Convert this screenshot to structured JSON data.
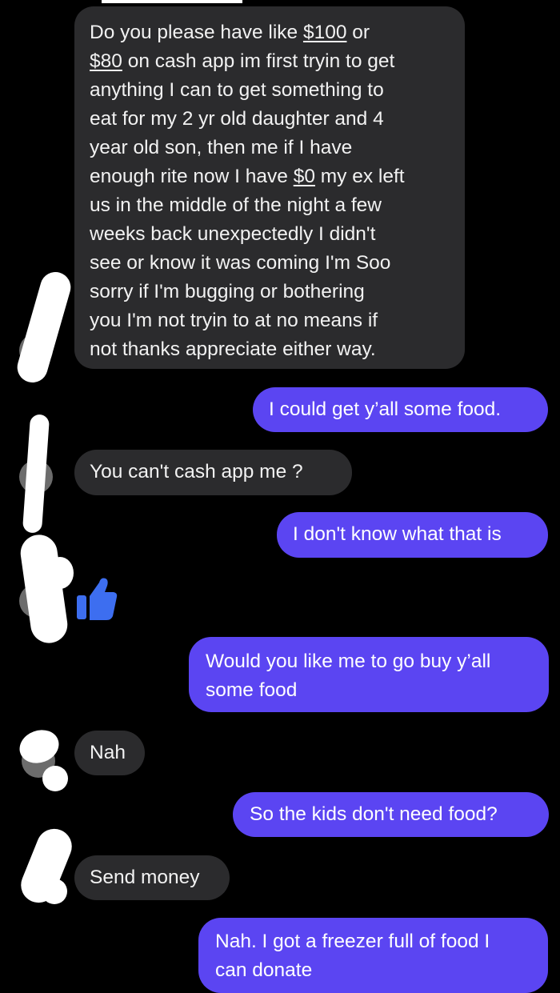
{
  "messages": [
    {
      "id": "m1",
      "side": "received",
      "lines": [
        [
          "Do you please have  like ",
          {
            "money": "$100"
          },
          " or"
        ],
        [
          {
            "money": "$80"
          },
          " on cash app im first tryin to get"
        ],
        [
          "anything I can to get something to"
        ],
        [
          "eat for my 2 yr old daughter and 4"
        ],
        [
          "year old son, then me if I have"
        ],
        [
          "enough rite now I have ",
          {
            "money": "$0"
          },
          " my ex left"
        ],
        [
          "us in the middle of the night a few"
        ],
        [
          "weeks back unexpectedly I didn't"
        ],
        [
          "see or know it was coming I'm  Soo"
        ],
        [
          "sorry  if I'm bugging or bothering"
        ],
        [
          "you I'm not tryin to at  no means if"
        ],
        [
          "not thanks  appreciate either way."
        ]
      ]
    },
    {
      "id": "m2",
      "side": "sent",
      "lines": [
        [
          "I could get y’all some food."
        ]
      ]
    },
    {
      "id": "m3",
      "side": "received",
      "lines": [
        [
          "You can't  cash app me ?"
        ]
      ]
    },
    {
      "id": "m4",
      "side": "sent",
      "lines": [
        [
          "I don't know what that is"
        ]
      ]
    },
    {
      "id": "m5",
      "side": "received",
      "reaction": "thumbs-up-icon"
    },
    {
      "id": "m6",
      "side": "sent",
      "lines": [
        [
          "Would you like me to go buy y’all"
        ],
        [
          "some food"
        ]
      ]
    },
    {
      "id": "m7",
      "side": "received",
      "lines": [
        [
          "Nah"
        ]
      ]
    },
    {
      "id": "m8",
      "side": "sent",
      "lines": [
        [
          "So the kids don't need food?"
        ]
      ]
    },
    {
      "id": "m9",
      "side": "received",
      "lines": [
        [
          "Send money"
        ]
      ]
    },
    {
      "id": "m10",
      "side": "sent",
      "lines": [
        [
          "Nah. I got a freezer full of food I"
        ],
        [
          "can donate"
        ]
      ]
    }
  ],
  "colors": {
    "background": "#000000",
    "received_bubble": "#2b2b2d",
    "sent_bubble": "#5b45f2",
    "thumbs_up": "#3d6ef0"
  }
}
